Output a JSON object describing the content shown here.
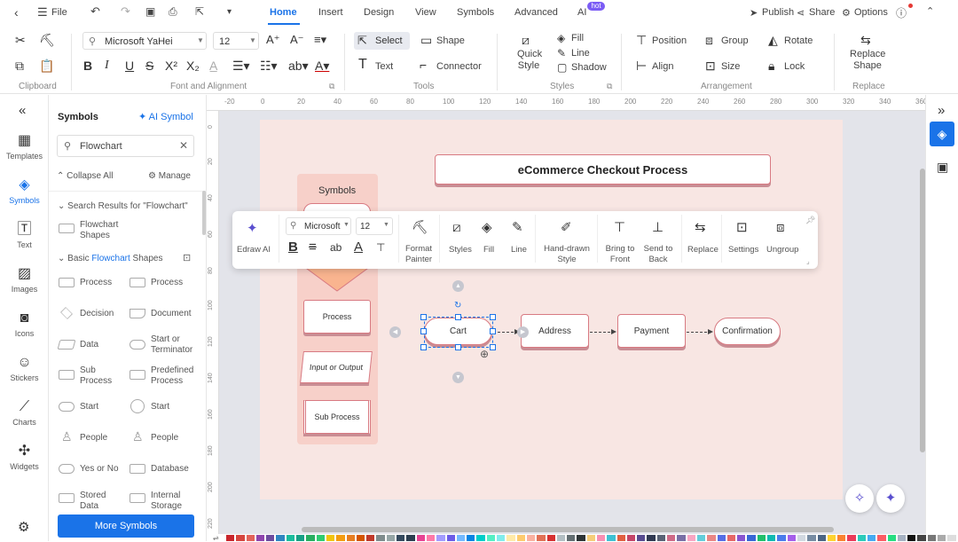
{
  "topbar": {
    "file_label": "File",
    "tabs": [
      "Home",
      "Insert",
      "Design",
      "View",
      "Symbols",
      "Advanced",
      "AI"
    ],
    "hot_badge": "hot",
    "publish": "Publish",
    "share": "Share",
    "options": "Options"
  },
  "ribbon": {
    "font_name": "Microsoft YaHei",
    "font_size": "12",
    "select": "Select",
    "shape": "Shape",
    "text": "Text",
    "connector": "Connector",
    "quick_style": "Quick Style",
    "fill": "Fill",
    "line": "Line",
    "shadow": "Shadow",
    "position": "Position",
    "group": "Group",
    "rotate": "Rotate",
    "align": "Align",
    "size": "Size",
    "lock": "Lock",
    "replace_shape": "Replace Shape",
    "groups": [
      "Clipboard",
      "Font and Alignment",
      "Tools",
      "Styles",
      "Arrangement",
      "Replace"
    ]
  },
  "leftnav": [
    "Templates",
    "Symbols",
    "Text",
    "Images",
    "Icons",
    "Stickers",
    "Charts",
    "Widgets"
  ],
  "symbols_panel": {
    "title": "Symbols",
    "ai_symbol": "AI Symbol",
    "search_value": "Flowchart",
    "collapse_all": "Collapse All",
    "manage": "Manage",
    "search_results": "Search Results for  \"Flowchart\"",
    "flowchart_shapes": "Flowchart Shapes",
    "section_prefix": "Basic ",
    "section_highlight": "Flowchart",
    "section_suffix": " Shapes",
    "shapes": [
      [
        "Process",
        "Process"
      ],
      [
        "Decision",
        "Document"
      ],
      [
        "Data",
        "Start or Terminator"
      ],
      [
        "Sub Process",
        "Predefined Process"
      ],
      [
        "Start",
        "Start"
      ],
      [
        "People",
        "People"
      ],
      [
        "Yes or No",
        "Database"
      ],
      [
        "Stored Data",
        "Internal Storage"
      ]
    ],
    "more_symbols": "More Symbols"
  },
  "ruler": {
    "top": [
      "-20",
      "0",
      "20",
      "40",
      "60",
      "80",
      "100",
      "120",
      "140",
      "160",
      "180",
      "200",
      "220",
      "240",
      "260",
      "280",
      "300",
      "320",
      "340",
      "360"
    ],
    "left": [
      "0",
      "20",
      "40",
      "60",
      "80",
      "100",
      "120",
      "140",
      "160",
      "180",
      "200",
      "220"
    ]
  },
  "canvas": {
    "title": "eCommerce Checkout Process",
    "symbols_label": "Symbols",
    "symbols_col_items": [
      "Process",
      "Input or Output",
      "Sub Process"
    ],
    "flow": [
      "Cart",
      "Address",
      "Payment",
      "Confirmation"
    ]
  },
  "float_toolbar": {
    "edraw_ai": "Edraw AI",
    "font": "Microsoft",
    "size": "12",
    "format_painter": "Format Painter",
    "styles": "Styles",
    "fill": "Fill",
    "line": "Line",
    "hand_drawn": "Hand-drawn Style",
    "bring_front": "Bring to Front",
    "send_back": "Send to Back",
    "replace": "Replace",
    "settings": "Settings",
    "ungroup": "Ungroup"
  },
  "palette": [
    "#c9252c",
    "#d6453f",
    "#e2625a",
    "#8e44ad",
    "#6d4c9f",
    "#2e86c1",
    "#1abc9c",
    "#16a085",
    "#27ae60",
    "#2ecc71",
    "#f1c40f",
    "#f39c12",
    "#e67e22",
    "#d35400",
    "#c0392b",
    "#7f8c8d",
    "#95a5a6",
    "#34495e",
    "#2c3e50",
    "#e84393",
    "#fd79a8",
    "#a29bfe",
    "#6c5ce7",
    "#74b9ff",
    "#0984e3",
    "#00cec9",
    "#55efc4",
    "#81ecec",
    "#ffeaa7",
    "#fdcb6e",
    "#fab1a0",
    "#e17055",
    "#d63031",
    "#b2bec3",
    "#636e72",
    "#2d3436",
    "#f5cd79",
    "#f78fb3",
    "#3dc1d3",
    "#e15f41",
    "#c44569",
    "#574b90",
    "#303952",
    "#596275",
    "#cf6a87",
    "#786fa6",
    "#f8a5c2",
    "#63cdda",
    "#ea8685",
    "#546de5",
    "#e66767",
    "#8854d0",
    "#3867d6",
    "#20bf6b",
    "#0fb9b1",
    "#4b7bec",
    "#a55eea",
    "#d1d8e0",
    "#778ca3",
    "#4b6584",
    "#fed330",
    "#fa8231",
    "#eb3b5a",
    "#2bcbba",
    "#45aaf2",
    "#fc5c65",
    "#26de81",
    "#a5b1c2",
    "#111111",
    "#444444",
    "#777777",
    "#aaaaaa",
    "#dddddd"
  ]
}
